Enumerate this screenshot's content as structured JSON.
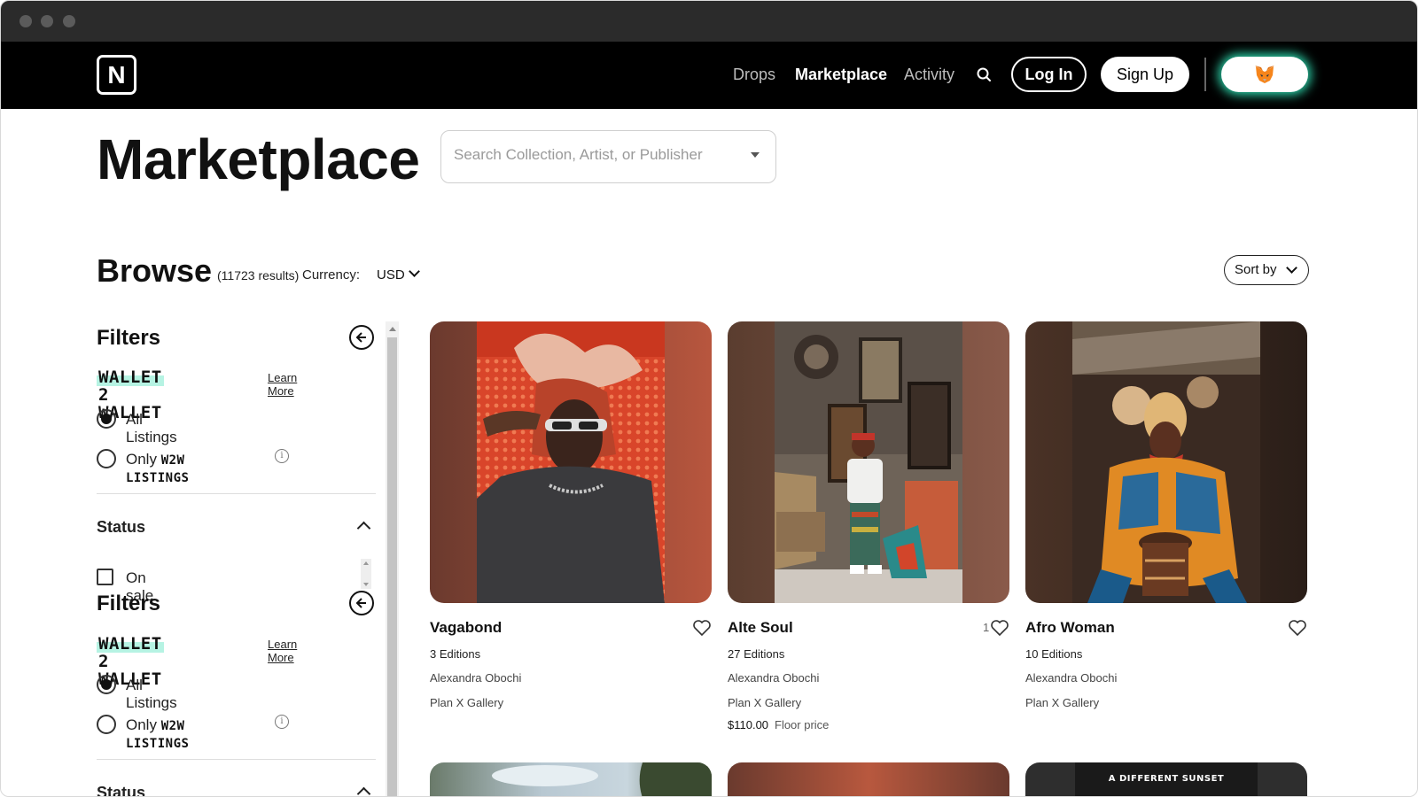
{
  "nav": {
    "logo": "N",
    "links": [
      "Drops",
      "Marketplace",
      "Activity"
    ],
    "login": "Log In",
    "signup": "Sign Up",
    "wallet_icon": "fox-icon"
  },
  "page": {
    "title": "Marketplace",
    "search_placeholder": "Search Collection, Artist, or Publisher"
  },
  "browse": {
    "title": "Browse",
    "results": "(11723 results)",
    "currency_label": "Currency:",
    "currency_value": "USD",
    "sort_label": "Sort by"
  },
  "filters": {
    "title": "Filters",
    "w2w_badge": "WALLET 2 WALLET",
    "learn_more": "Learn More",
    "all_listings": "All Listings",
    "only": "Only",
    "w2w_listings": "W2W LISTINGS",
    "status_title": "Status",
    "on_sale": "On sale",
    "info_glyph": "i"
  },
  "cards": [
    {
      "title": "Vagabond",
      "editions": "3 Editions",
      "artist": "Alexandra Obochi",
      "gallery": "Plan X Gallery",
      "likes": "",
      "price": "",
      "price_label": ""
    },
    {
      "title": "Alte Soul",
      "editions": "27 Editions",
      "artist": "Alexandra Obochi",
      "gallery": "Plan X Gallery",
      "likes": "1",
      "price": "$110.00",
      "price_label": "Floor price"
    },
    {
      "title": "Afro Woman",
      "editions": "10 Editions",
      "artist": "Alexandra Obochi",
      "gallery": "Plan X Gallery",
      "likes": "",
      "price": "",
      "price_label": ""
    }
  ],
  "bottom_cards": [
    {
      "text": ""
    },
    {
      "text": ""
    },
    {
      "text": "A DIFFERENT SUNSET"
    }
  ],
  "colors": {
    "nav_bg": "#000000",
    "accent_glow": "#2fe0b4",
    "badge_highlight": "#b6f3e3"
  }
}
